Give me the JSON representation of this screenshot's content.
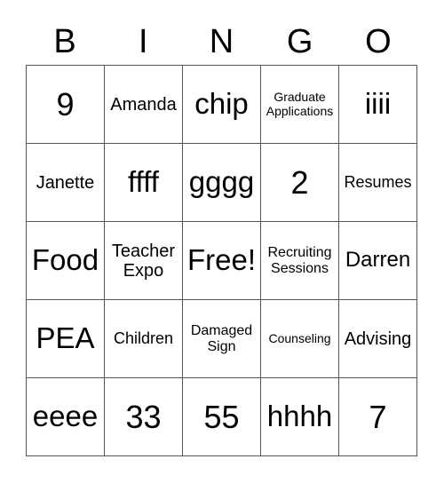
{
  "header": {
    "letters": [
      "B",
      "I",
      "N",
      "G",
      "O"
    ]
  },
  "grid": {
    "rows": [
      [
        "9",
        "Amanda",
        "chip",
        "Graduate\nApplications",
        "iiii"
      ],
      [
        "Janette",
        "ffff",
        "gggg",
        "2",
        "Resumes"
      ],
      [
        "Food",
        "Teacher\nExpo",
        "Free!",
        "Recruiting\nSessions",
        "Darren"
      ],
      [
        "PEA",
        "Children",
        "Damaged\nSign",
        "Counseling",
        "Advising"
      ],
      [
        "eeee",
        "33",
        "55",
        "hhhh",
        "7"
      ]
    ]
  }
}
